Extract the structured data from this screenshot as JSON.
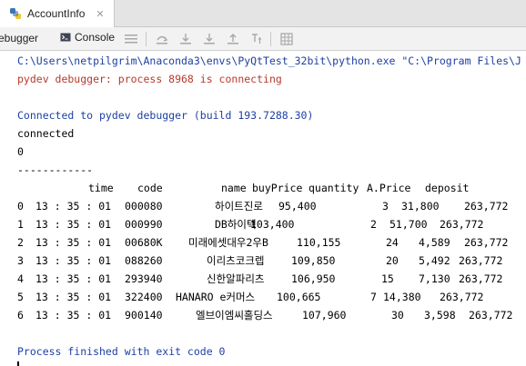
{
  "tab": {
    "title": "AccountInfo",
    "close": "✕",
    "icon": "python-icon"
  },
  "toolbar": {
    "debugger_label": "ebugger",
    "console_label": "Console"
  },
  "console": {
    "cmd_line": "C:\\Users\\netpilgrim\\Anaconda3\\envs\\PyQtTest_32bit\\python.exe \"C:\\Program Files\\J",
    "connecting_line": "pydev debugger: process 8968 is connecting",
    "connected_line": "Connected to pydev debugger (build 193.7288.30)",
    "connected_word": "connected",
    "zero": "0",
    "dashes": "------------",
    "headers": [
      "time",
      "code",
      "name",
      "buyPrice",
      "quantity",
      "A.Price",
      "deposit"
    ],
    "rows": [
      {
        "idx": "0",
        "time": "13 : 35 : 01",
        "code": "000080",
        "name": "하이트진로",
        "buyPrice": "95,400",
        "quantity": "3",
        "aprice": "31,800",
        "deposit": "263,772"
      },
      {
        "idx": "1",
        "time": "13 : 35 : 01",
        "code": "000990",
        "name": "DB하이텍",
        "buyPrice": "103,400",
        "quantity": "2",
        "aprice": "51,700",
        "deposit": "263,772"
      },
      {
        "idx": "2",
        "time": "13 : 35 : 01",
        "code": "00680K",
        "name": "미래에셋대우2우B",
        "buyPrice": "110,155",
        "quantity": "24",
        "aprice": "4,589",
        "deposit": "263,772"
      },
      {
        "idx": "3",
        "time": "13 : 35 : 01",
        "code": "088260",
        "name": "이리츠코크렙",
        "buyPrice": "109,850",
        "quantity": "20",
        "aprice": "5,492",
        "deposit": "263,772"
      },
      {
        "idx": "4",
        "time": "13 : 35 : 01",
        "code": "293940",
        "name": "신한알파리츠",
        "buyPrice": "106,950",
        "quantity": "15",
        "aprice": "7,130",
        "deposit": "263,772"
      },
      {
        "idx": "5",
        "time": "13 : 35 : 01",
        "code": "322400",
        "name": "HANARO e커머스",
        "buyPrice": "100,665",
        "quantity": "7",
        "aprice": "14,380",
        "deposit": "263,772"
      },
      {
        "idx": "6",
        "time": "13 : 35 : 01",
        "code": "900140",
        "name": "엘브이엠씨홀딩스",
        "buyPrice": "107,960",
        "quantity": "30",
        "aprice": "3,598",
        "deposit": "263,772"
      }
    ],
    "finished_line": "Process finished with exit code 0"
  },
  "colors": {
    "blue": "#1d3fa3",
    "red": "#b63a2a",
    "icon_gray": "#a7a7a7"
  }
}
